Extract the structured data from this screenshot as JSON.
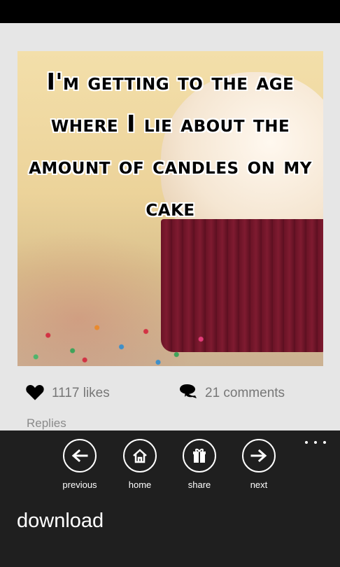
{
  "post": {
    "caption": "I'm getting to the age where I lie about the amount of candles on my cake",
    "likes": "1117 likes",
    "comments": "21 comments",
    "replies_label": "Replies"
  },
  "icons": {
    "likes": "heart-icon",
    "comments": "speech-bubbles-icon",
    "previous": "arrow-left-icon",
    "home": "house-icon",
    "share": "gift-icon",
    "next": "arrow-right-icon",
    "more": "ellipsis-icon"
  },
  "appbar": {
    "buttons": [
      {
        "label": "previous"
      },
      {
        "label": "home"
      },
      {
        "label": "share"
      },
      {
        "label": "next"
      }
    ],
    "menu": {
      "download": "download"
    }
  },
  "colors": {
    "content_bg": "#e6e6e6",
    "appbar_bg": "#1f1f1f",
    "status_bar": "#000000",
    "muted_text": "#777777"
  }
}
